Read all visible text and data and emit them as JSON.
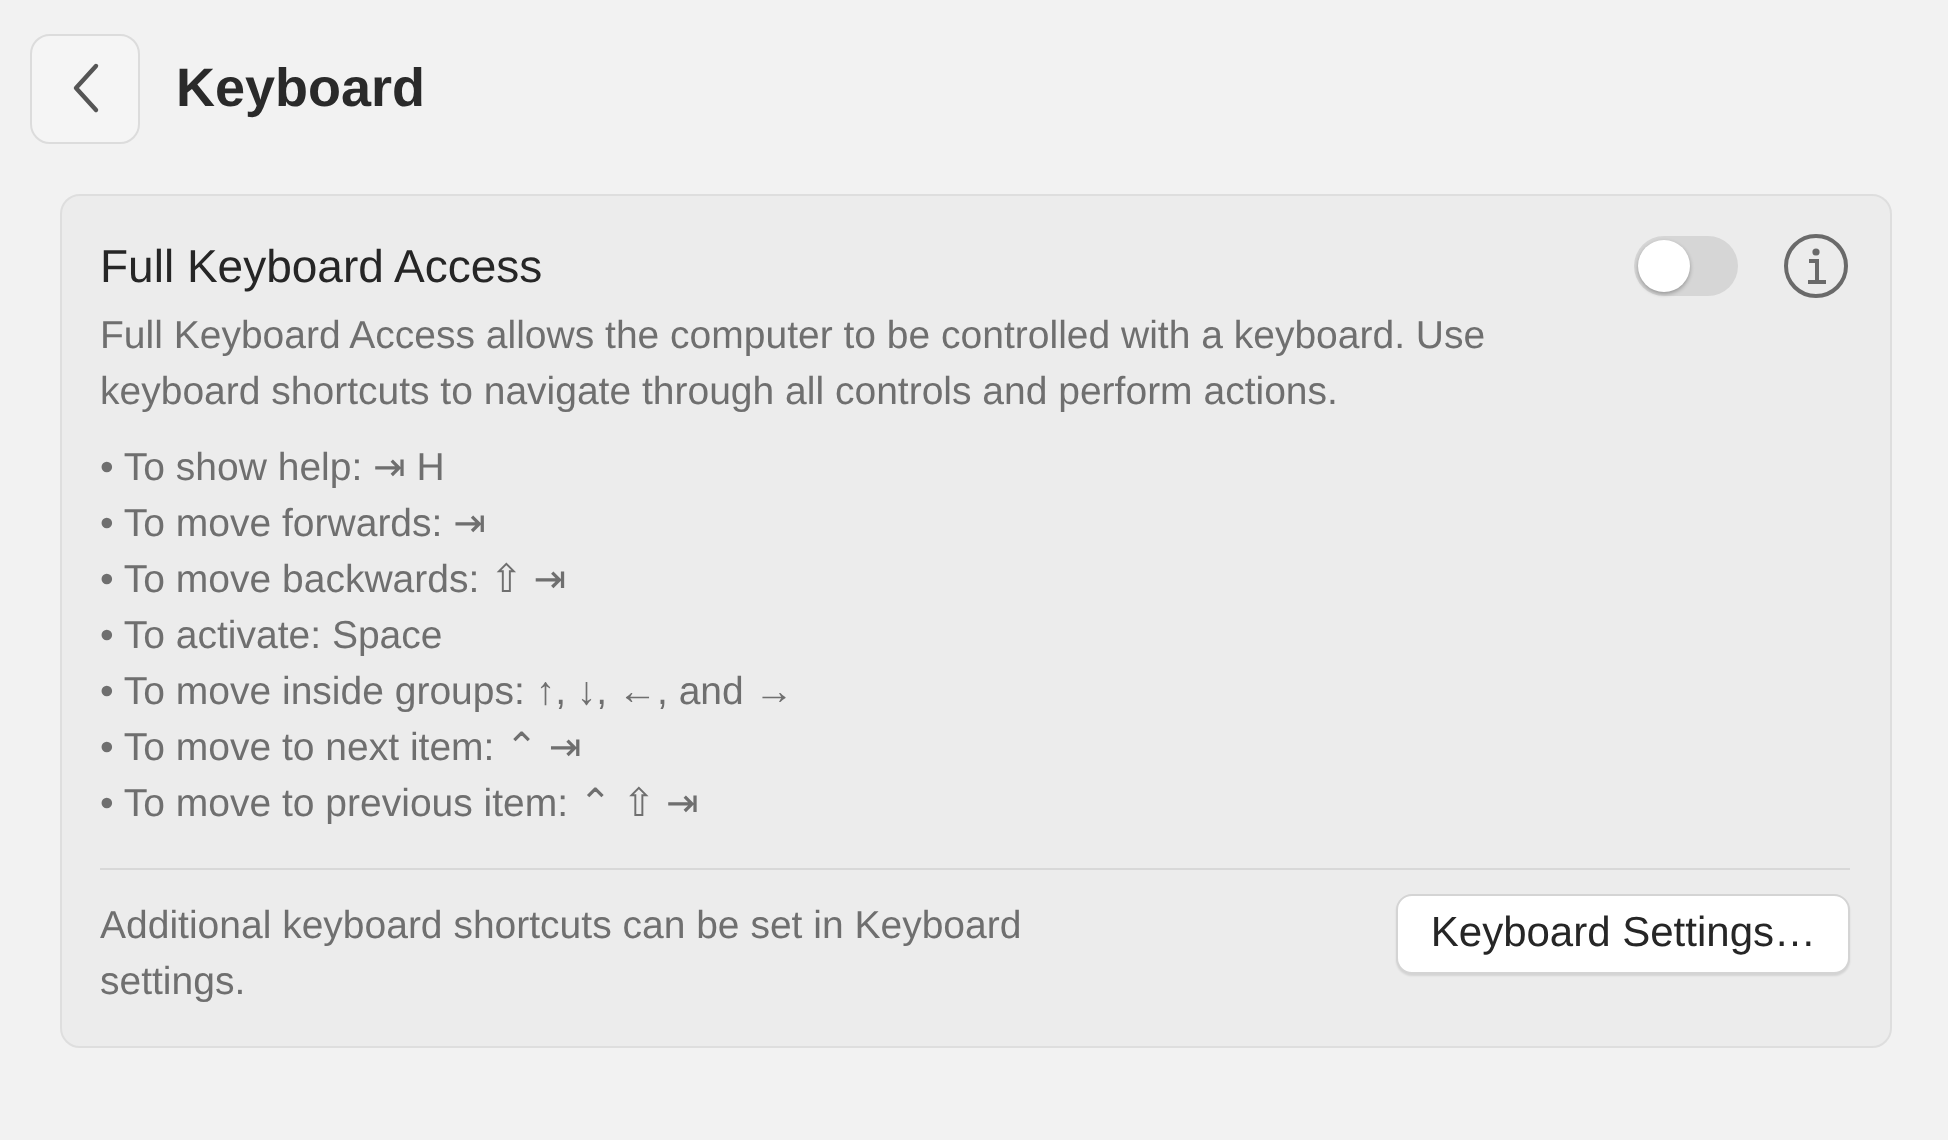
{
  "header": {
    "title": "Keyboard"
  },
  "section": {
    "title": "Full Keyboard Access",
    "toggle": {
      "on": false
    },
    "description": "Full Keyboard Access allows the computer to be controlled with a keyboard. Use keyboard shortcuts to navigate through all controls and perform actions.",
    "shortcuts": [
      "• To show help: ⇥ H",
      "• To move forwards: ⇥",
      "• To move backwards: ⇧ ⇥",
      "• To activate: Space",
      "• To move inside groups: ↑, ↓, ←, and →",
      "• To move to next item: ⌃ ⇥",
      "• To move to previous item: ⌃ ⇧ ⇥"
    ],
    "footer_note": "Additional keyboard shortcuts can be set in Keyboard settings.",
    "button": "Keyboard Settings…"
  }
}
